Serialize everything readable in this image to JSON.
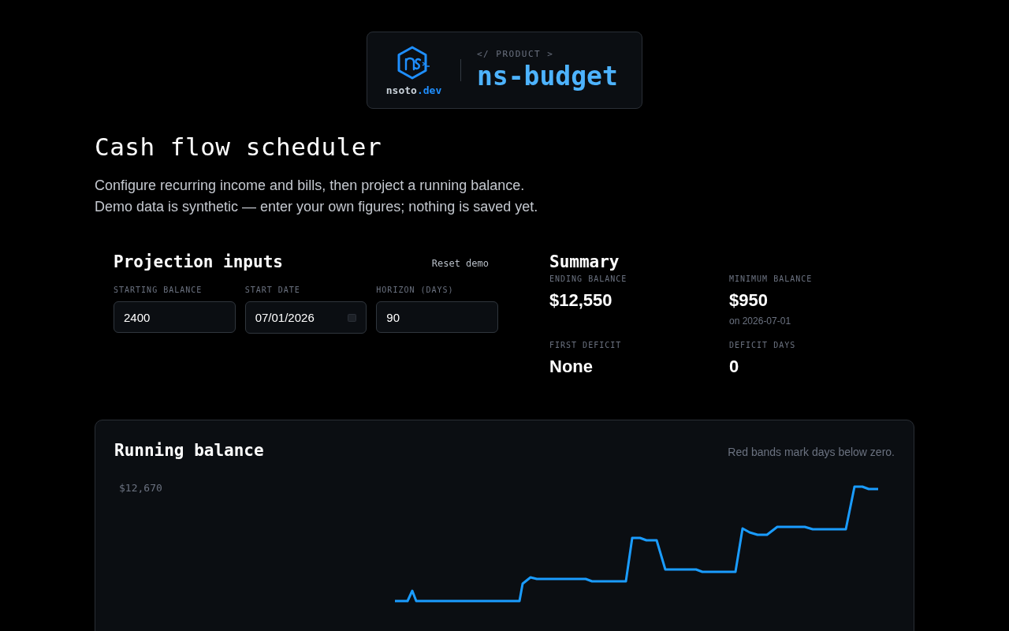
{
  "brand": {
    "site": "nsoto",
    "tld": ".dev",
    "eyebrow": "</ PRODUCT >",
    "product": "ns-budget"
  },
  "page": {
    "title": "Cash flow scheduler",
    "description": [
      "Configure recurring income and bills, then project a running balance.",
      "Demo data is synthetic — enter your own figures; nothing is saved yet."
    ]
  },
  "inputs": {
    "title": "Projection inputs",
    "reset": "Reset demo",
    "fields": [
      {
        "label": "STARTING BALANCE",
        "value": "2400",
        "kind": "text"
      },
      {
        "label": "START DATE",
        "value": "07/01/2026",
        "kind": "date"
      },
      {
        "label": "HORIZON (DAYS)",
        "value": "90",
        "kind": "text"
      }
    ]
  },
  "summary": {
    "title": "Summary",
    "stats": [
      {
        "label": "ENDING BALANCE",
        "value": "$12,550"
      },
      {
        "label": "MINIMUM BALANCE",
        "value": "$950",
        "note": "on 2026-07-01"
      },
      {
        "label": "FIRST DEFICIT",
        "value": "None"
      },
      {
        "label": "DEFICIT DAYS",
        "value": "0"
      }
    ]
  },
  "chart": {
    "title": "Running balance",
    "hint": "Red bands mark days below zero.",
    "top_label": "$12,670"
  }
}
